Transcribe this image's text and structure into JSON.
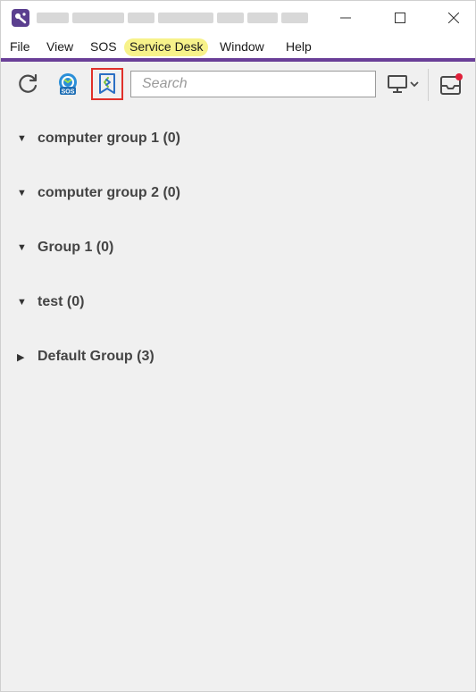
{
  "menu": {
    "items": [
      {
        "label": "File"
      },
      {
        "label": "View"
      },
      {
        "label": "SOS"
      },
      {
        "label": "Service Desk"
      },
      {
        "label": "Window"
      },
      {
        "label": "Help"
      }
    ]
  },
  "toolbar": {
    "search_placeholder": "Search"
  },
  "groups": [
    {
      "label": "computer group 1 (0)",
      "expanded": true
    },
    {
      "label": "computer group 2 (0)",
      "expanded": true
    },
    {
      "label": "Group 1 (0)",
      "expanded": true
    },
    {
      "label": "test (0)",
      "expanded": true
    },
    {
      "label": "Default Group (3)",
      "expanded": false
    }
  ],
  "colors": {
    "accent": "#6a3f98",
    "highlight": "#f7f28a",
    "selection_outline": "#e0302a",
    "notification_dot": "#e0203a"
  },
  "icons": {
    "refresh": "refresh-icon",
    "sos": "sos-icon",
    "service_desk": "service-desk-icon",
    "monitor": "monitor-dropdown-icon",
    "inbox": "inbox-notification-icon"
  }
}
